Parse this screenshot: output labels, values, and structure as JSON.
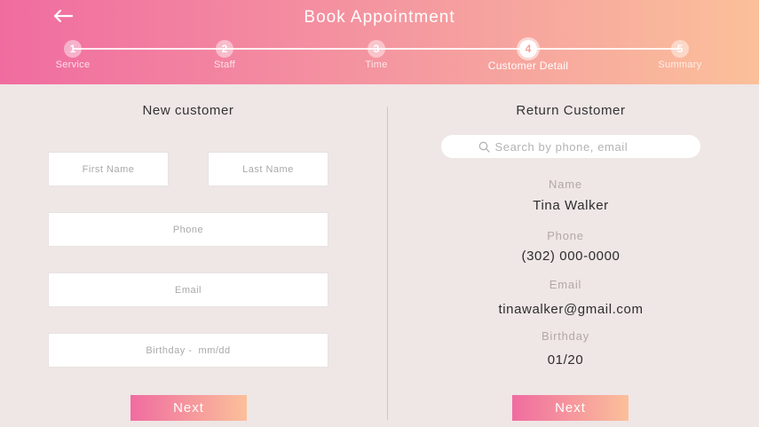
{
  "header": {
    "title": "Book Appointment",
    "back_icon": "arrow-left-icon"
  },
  "steps": [
    {
      "number": "1",
      "label": "Service"
    },
    {
      "number": "2",
      "label": "Staff"
    },
    {
      "number": "3",
      "label": "Time"
    },
    {
      "number": "4",
      "label": "Customer Detail"
    },
    {
      "number": "5",
      "label": "Summary"
    }
  ],
  "active_step": 4,
  "new_customer": {
    "title": "New customer",
    "first_name_placeholder": "First Name",
    "last_name_placeholder": "Last Name",
    "phone_placeholder": "Phone",
    "email_placeholder": "Email",
    "birthday_placeholder": "Birthday -  mm/dd",
    "next_label": "Next"
  },
  "return_customer": {
    "title": "Return Customer",
    "search_placeholder": "Search by phone, email",
    "search_icon": "search-icon",
    "name_label": "Name",
    "name_value": "Tina Walker",
    "phone_label": "Phone",
    "phone_value": "(302) 000-0000",
    "email_label": "Email",
    "email_value": "tinawalker@gmail.com",
    "birthday_label": "Birthday",
    "birthday_value": "01/20",
    "next_label": "Next"
  },
  "colors": {
    "gradient_start": "#f06ca0",
    "gradient_end": "#fbc09a",
    "background": "#efe6e6"
  }
}
